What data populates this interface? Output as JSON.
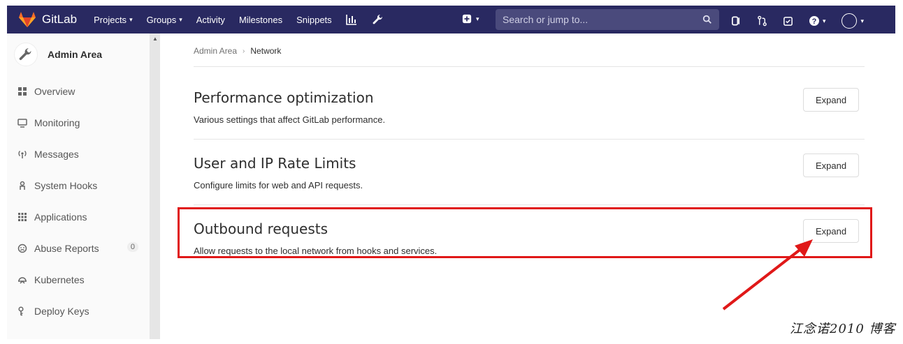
{
  "navbar": {
    "brand": "GitLab",
    "links": [
      {
        "label": "Projects",
        "caret": true
      },
      {
        "label": "Groups",
        "caret": true
      },
      {
        "label": "Activity",
        "caret": false
      },
      {
        "label": "Milestones",
        "caret": false
      },
      {
        "label": "Snippets",
        "caret": false
      }
    ],
    "search_placeholder": "Search or jump to...",
    "colors": {
      "background": "#292961",
      "search": "#4a4a7c"
    }
  },
  "sidebar": {
    "title": "Admin Area",
    "items": [
      {
        "label": "Overview",
        "icon": "overview-icon"
      },
      {
        "label": "Monitoring",
        "icon": "monitor-icon"
      },
      {
        "label": "Messages",
        "icon": "broadcast-icon"
      },
      {
        "label": "System Hooks",
        "icon": "hook-icon"
      },
      {
        "label": "Applications",
        "icon": "applications-icon"
      },
      {
        "label": "Abuse Reports",
        "icon": "abuse-icon",
        "badge": "0"
      },
      {
        "label": "Kubernetes",
        "icon": "kubernetes-icon"
      },
      {
        "label": "Deploy Keys",
        "icon": "key-icon"
      }
    ]
  },
  "breadcrumb": {
    "parent": "Admin Area",
    "current": "Network"
  },
  "sections": [
    {
      "title": "Performance optimization",
      "description": "Various settings that affect GitLab performance.",
      "button": "Expand"
    },
    {
      "title": "User and IP Rate Limits",
      "description": "Configure limits for web and API requests.",
      "button": "Expand"
    },
    {
      "title": "Outbound requests",
      "description": "Allow requests to the local network from hooks and services.",
      "button": "Expand"
    }
  ],
  "annotation": {
    "highlight_color": "#e01818"
  },
  "watermark": "江念诺2010 博客"
}
